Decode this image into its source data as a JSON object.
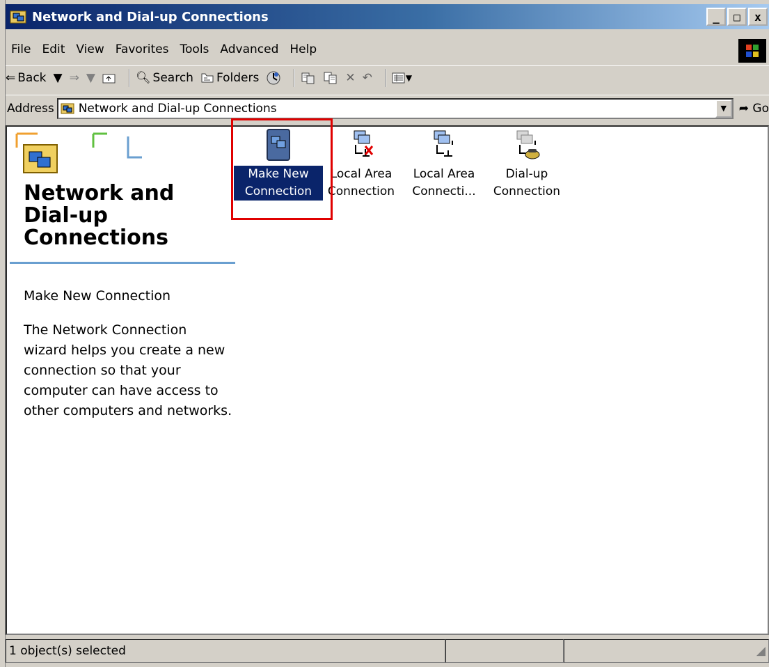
{
  "window": {
    "title": "Network and Dial-up Connections",
    "minimize_glyph": "_",
    "maximize_glyph": "□",
    "close_glyph": "x"
  },
  "menu": [
    "File",
    "Edit",
    "View",
    "Favorites",
    "Tools",
    "Advanced",
    "Help"
  ],
  "toolbar": {
    "back_label": "Back",
    "search_label": "Search",
    "folders_label": "Folders"
  },
  "address": {
    "label": "Address",
    "value": "Network and Dial-up Connections",
    "go_label": "Go"
  },
  "sidebar": {
    "title": "Network and Dial-up Connections",
    "heading": "Make New Connection",
    "description": "The Network Connection wizard helps you create a new connection so that your computer can have access to other computers and networks."
  },
  "icons": [
    {
      "label": "Make New Connection",
      "selected": true
    },
    {
      "label": "Local Area Connection",
      "selected": false
    },
    {
      "label": "Local Area Connecti...",
      "selected": false
    },
    {
      "label": "Dial-up Connection",
      "selected": false
    }
  ],
  "status": {
    "text": "1 object(s) selected"
  },
  "colors": {
    "title_bar": "#0a246a",
    "selection": "#0a246a",
    "highlight_box": "#e00000",
    "face": "#d4d0c8"
  }
}
